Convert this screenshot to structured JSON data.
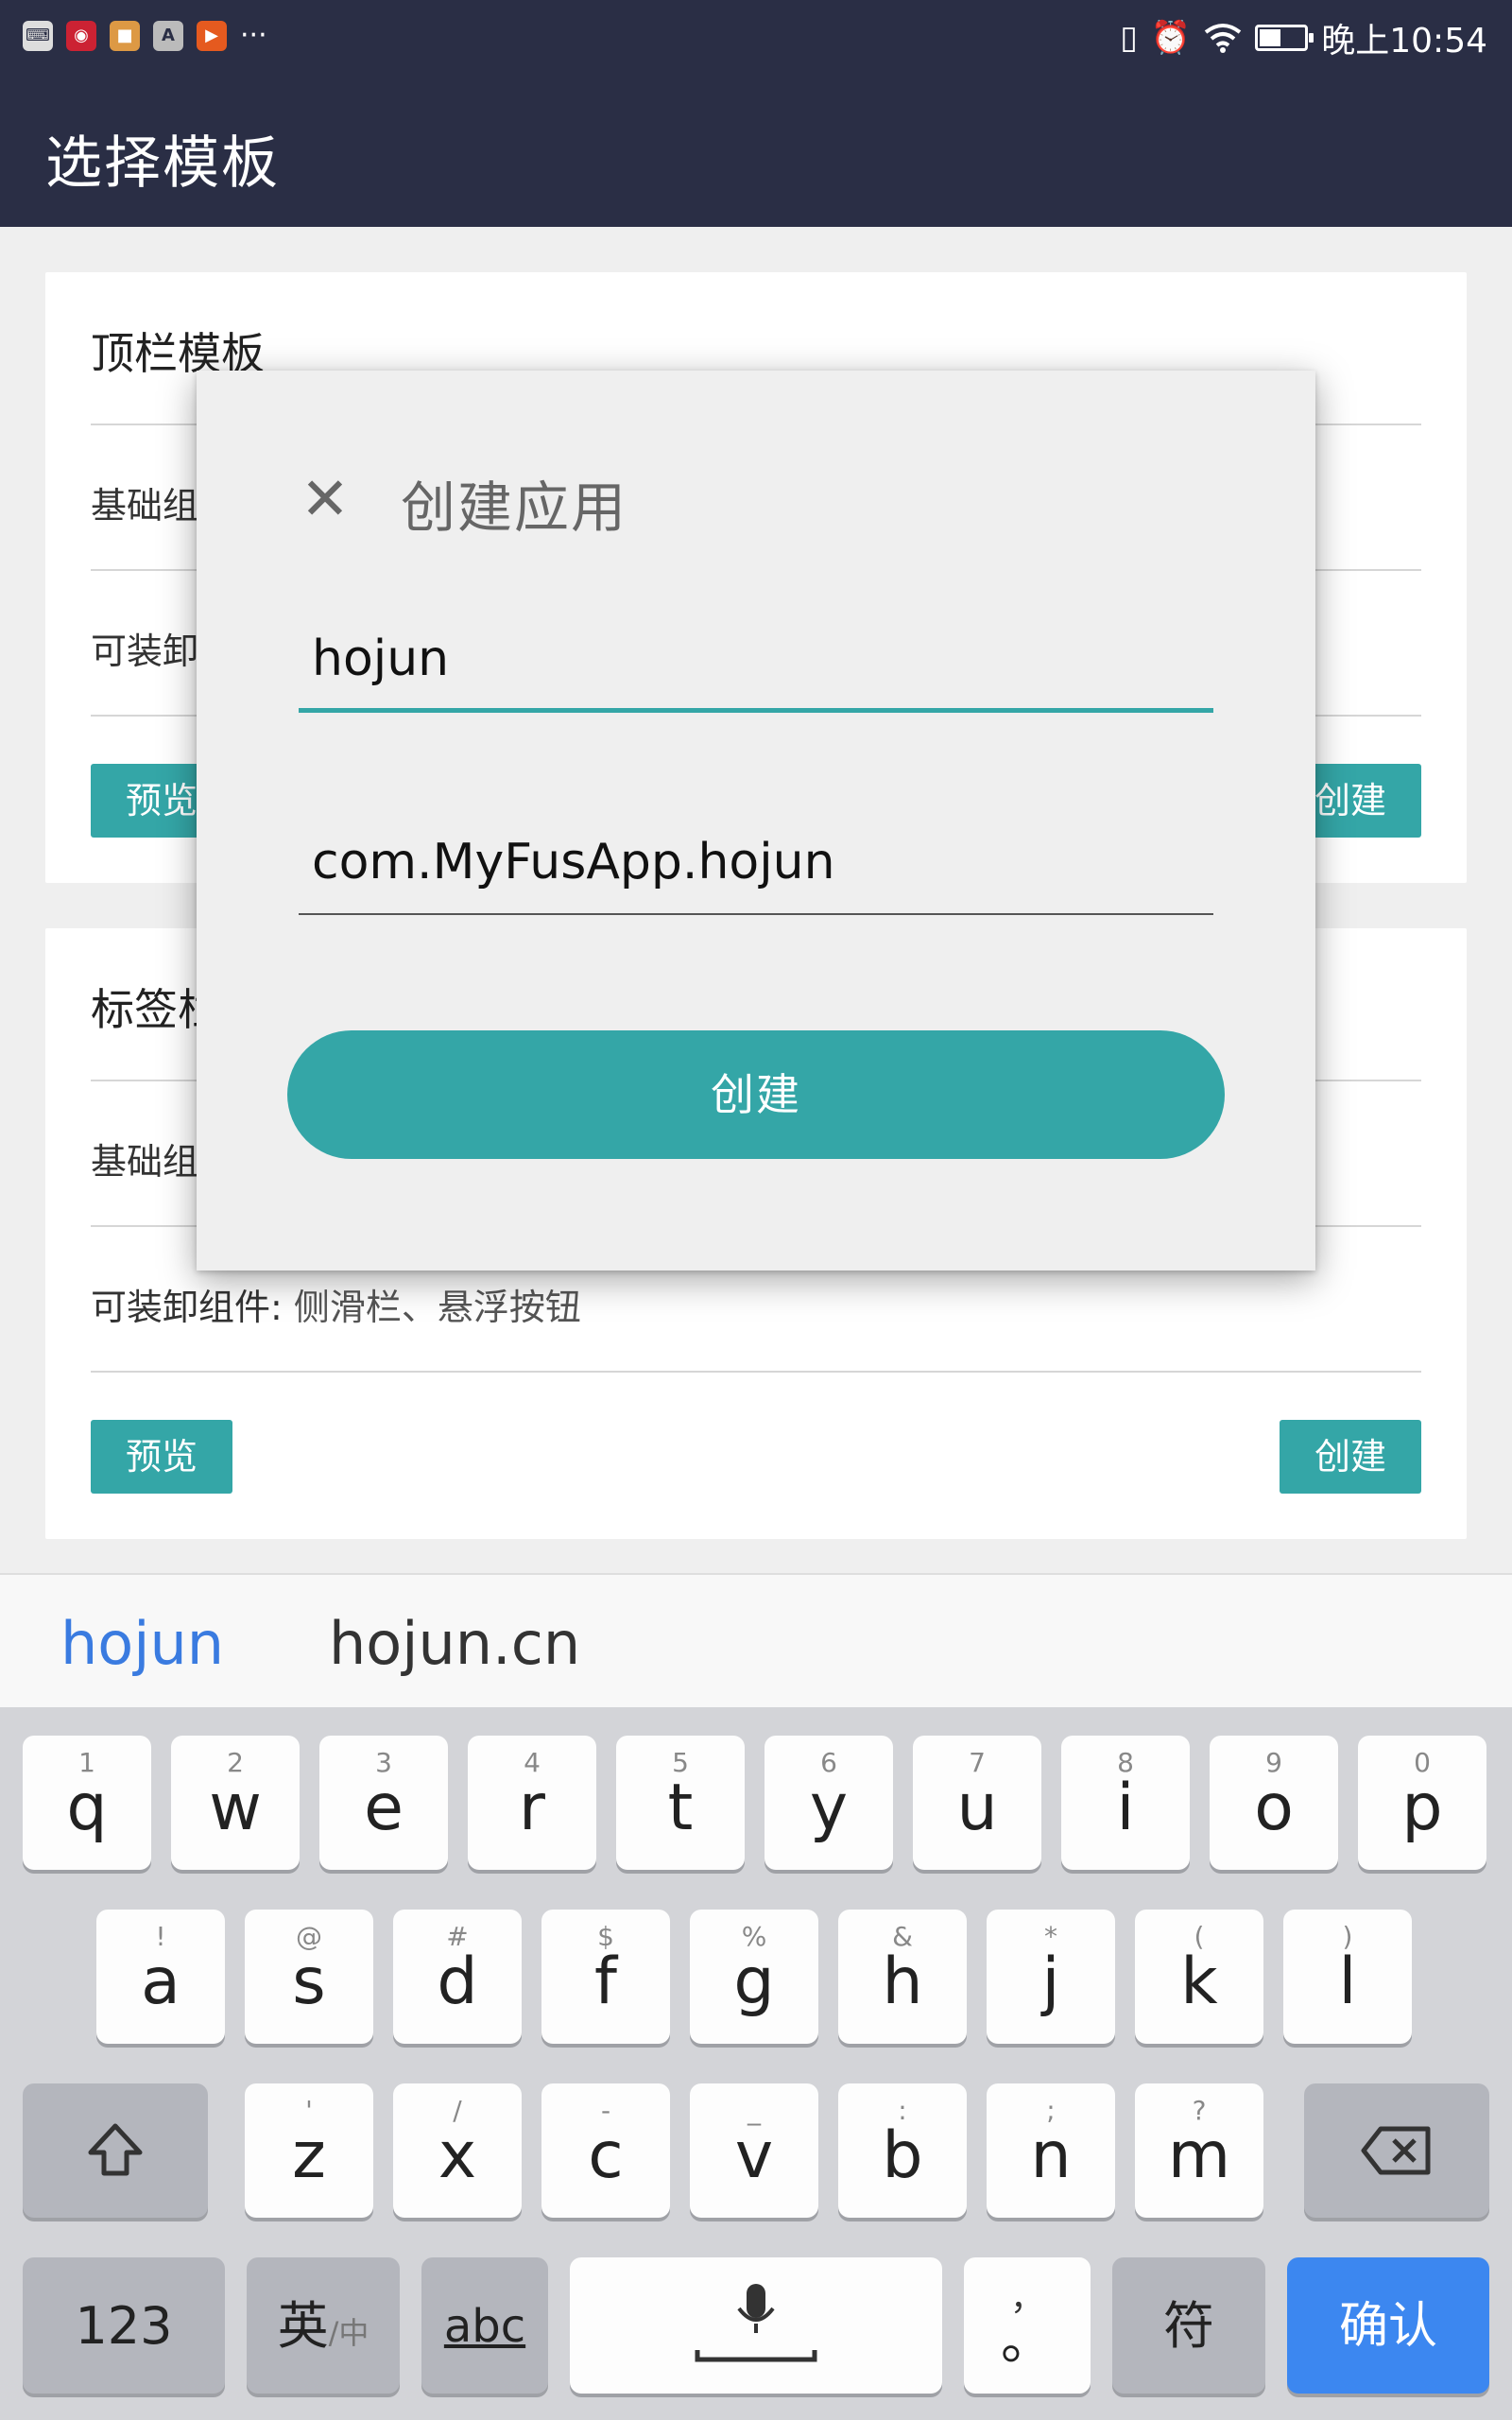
{
  "status_bar": {
    "time": "晚上10:54"
  },
  "app_bar": {
    "title": "选择模板"
  },
  "cards": [
    {
      "title": "顶栏模板",
      "rows": [
        {
          "label": "基础组"
        },
        {
          "label": "可装卸"
        }
      ],
      "preview_label": "预览",
      "create_label": "创建"
    },
    {
      "title": "标签栏",
      "rows": [
        {
          "label": "基础组"
        },
        {
          "label": "可装卸组件:",
          "value": "侧滑栏、悬浮按钮"
        }
      ],
      "preview_label": "预览",
      "create_label": "创建"
    }
  ],
  "dialog": {
    "title": "创建应用",
    "app_name_value": "hojun",
    "package_value": "com.MyFusApp.hojun",
    "create_label": "创建"
  },
  "suggestions": [
    "hojun",
    "hojun.cn"
  ],
  "keyboard": {
    "row1": [
      {
        "hint": "1",
        "ch": "q"
      },
      {
        "hint": "2",
        "ch": "w"
      },
      {
        "hint": "3",
        "ch": "e"
      },
      {
        "hint": "4",
        "ch": "r"
      },
      {
        "hint": "5",
        "ch": "t"
      },
      {
        "hint": "6",
        "ch": "y"
      },
      {
        "hint": "7",
        "ch": "u"
      },
      {
        "hint": "8",
        "ch": "i"
      },
      {
        "hint": "9",
        "ch": "o"
      },
      {
        "hint": "0",
        "ch": "p"
      }
    ],
    "row2": [
      {
        "hint": "!",
        "ch": "a"
      },
      {
        "hint": "@",
        "ch": "s"
      },
      {
        "hint": "#",
        "ch": "d"
      },
      {
        "hint": "$",
        "ch": "f"
      },
      {
        "hint": "%",
        "ch": "g"
      },
      {
        "hint": "&",
        "ch": "h"
      },
      {
        "hint": "*",
        "ch": "j"
      },
      {
        "hint": "(",
        "ch": "k"
      },
      {
        "hint": ")",
        "ch": "l"
      }
    ],
    "row3": [
      {
        "hint": "'",
        "ch": "z"
      },
      {
        "hint": "/",
        "ch": "x"
      },
      {
        "hint": "-",
        "ch": "c"
      },
      {
        "hint": "_",
        "ch": "v"
      },
      {
        "hint": ":",
        "ch": "b"
      },
      {
        "hint": ";",
        "ch": "n"
      },
      {
        "hint": "?",
        "ch": "m"
      }
    ],
    "num_label": "123",
    "lang_label": "英",
    "lang_sub": "/中",
    "abc_label": "abc",
    "comma_hint": "，",
    "period": "。",
    "symbols_label": "符",
    "confirm_label": "确认"
  }
}
